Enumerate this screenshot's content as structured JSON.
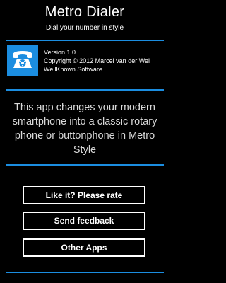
{
  "header": {
    "title": "Metro Dialer",
    "subtitle": "Dial your number in style"
  },
  "about": {
    "logo_icon": "rotary-phone-icon",
    "version": "Version 1.0",
    "copyright": "Copyright © 2012 Marcel van der Wel",
    "company": "WellKnown Software"
  },
  "description": "This app changes your modern smartphone into a classic rotary phone or buttonphone in Metro Style",
  "buttons": {
    "rate": "Like it? Please rate",
    "feedback": "Send feedback",
    "other_apps": "Other Apps"
  },
  "colors": {
    "accent": "#1b8de0",
    "background": "#000000",
    "text": "#ffffff"
  }
}
